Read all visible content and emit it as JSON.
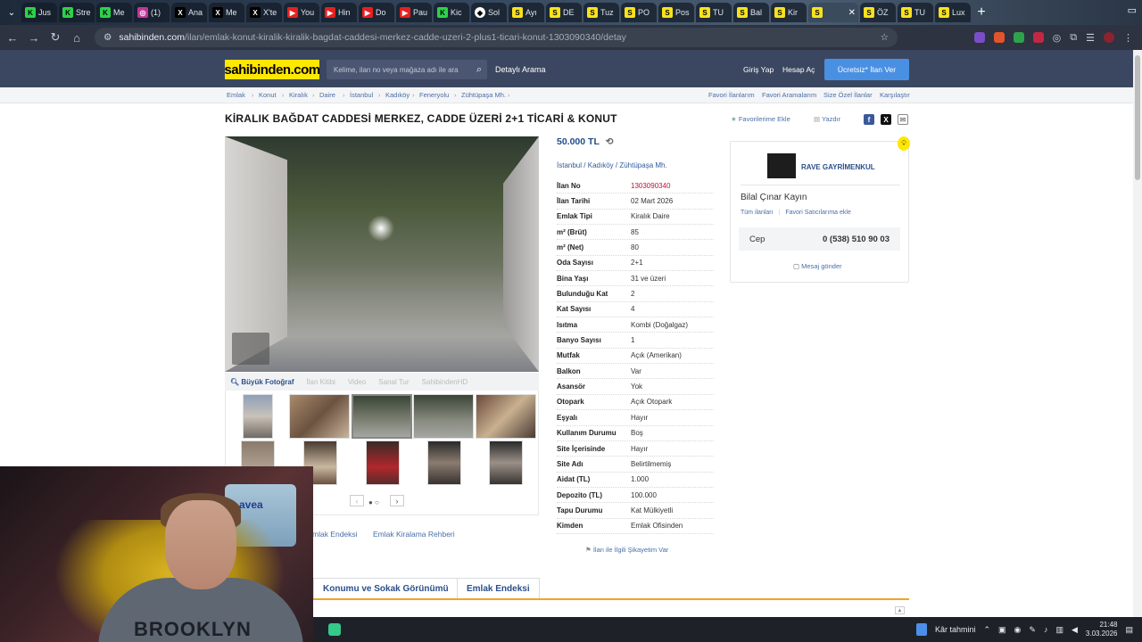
{
  "browser": {
    "tabs": [
      {
        "icon": "k",
        "label": "Jus"
      },
      {
        "icon": "k",
        "label": "Stre"
      },
      {
        "icon": "k",
        "label": "Me"
      },
      {
        "icon": "i",
        "label": "(1)"
      },
      {
        "icon": "x",
        "label": "Ana"
      },
      {
        "icon": "x",
        "label": "Me"
      },
      {
        "icon": "x",
        "label": "X'te"
      },
      {
        "icon": "y",
        "label": "You"
      },
      {
        "icon": "y",
        "label": "Hin"
      },
      {
        "icon": "y",
        "label": "Do"
      },
      {
        "icon": "y",
        "label": "Pau"
      },
      {
        "icon": "k",
        "label": "Kic"
      },
      {
        "icon": "d",
        "label": "Sol"
      },
      {
        "icon": "s",
        "label": "Ayı"
      },
      {
        "icon": "s",
        "label": "DE"
      },
      {
        "icon": "s",
        "label": "Tuz"
      },
      {
        "icon": "s",
        "label": "PO"
      },
      {
        "icon": "s",
        "label": "Pos"
      },
      {
        "icon": "s",
        "label": "TU"
      },
      {
        "icon": "s",
        "label": "Bal"
      },
      {
        "icon": "s",
        "label": "Kir"
      },
      {
        "icon": "s",
        "label": "",
        "active": true
      },
      {
        "icon": "s",
        "label": "ÖZ"
      },
      {
        "icon": "s",
        "label": "TU"
      },
      {
        "icon": "s",
        "label": "Lux"
      }
    ],
    "new_tab": "+",
    "url_host": "sahibinden.com",
    "url_path": "/ilan/emlak-konut-kiralik-kiralik-bagdat-caddesi-merkez-cadde-uzeri-2-plus1-ticari-konut-1303090340/detay"
  },
  "header": {
    "logo": "sahibinden.com",
    "search_placeholder": "Kelime, ilan no veya mağaza adı ile ara",
    "detailed_search": "Detaylı Arama",
    "login": "Giriş Yap",
    "register": "Hesap Aç",
    "cta": "Ücretsiz* İlan Ver"
  },
  "breadcrumb": {
    "items": [
      "Emlak",
      "Konut",
      "Kiralık",
      "Daire",
      "İstanbul",
      "Kadıköy",
      "Feneryolu",
      "Zühtüpaşa Mh."
    ],
    "right_links": [
      "Favori İlanlarım",
      "Favori Aramalarım",
      "Size Özel İlanlar",
      "Karşılaştır"
    ]
  },
  "listing": {
    "title": "KİRALIK BAĞDAT CADDESİ MERKEZ, CADDE ÜZERİ 2+1 TİCARİ & KONUT",
    "add_favorite": "Favorilerime Ekle",
    "print": "Yazdır",
    "price": "50.000 TL",
    "location": [
      "İstanbul",
      "Kadıköy",
      "Zühtüpaşa Mh."
    ],
    "photo_tools": [
      "Büyük Fotoğraf",
      "İlan Kitibi",
      "Video",
      "Sanal Tur",
      "SahibindenHD"
    ],
    "details": [
      {
        "k": "İlan No",
        "v": "1303090340"
      },
      {
        "k": "İlan Tarihi",
        "v": "02 Mart 2026"
      },
      {
        "k": "Emlak Tipi",
        "v": "Kiralık Daire"
      },
      {
        "k": "m² (Brüt)",
        "v": "85"
      },
      {
        "k": "m² (Net)",
        "v": "80"
      },
      {
        "k": "Oda Sayısı",
        "v": "2+1"
      },
      {
        "k": "Bina Yaşı",
        "v": "31 ve üzeri"
      },
      {
        "k": "Bulunduğu Kat",
        "v": "2"
      },
      {
        "k": "Kat Sayısı",
        "v": "4"
      },
      {
        "k": "Isıtma",
        "v": "Kombi (Doğalgaz)"
      },
      {
        "k": "Banyo Sayısı",
        "v": "1"
      },
      {
        "k": "Mutfak",
        "v": "Açık (Amerikan)"
      },
      {
        "k": "Balkon",
        "v": "Var"
      },
      {
        "k": "Asansör",
        "v": "Yok"
      },
      {
        "k": "Otopark",
        "v": "Açık Otopark"
      },
      {
        "k": "Eşyalı",
        "v": "Hayır"
      },
      {
        "k": "Kullanım Durumu",
        "v": "Boş"
      },
      {
        "k": "Site İçerisinde",
        "v": "Hayır"
      },
      {
        "k": "Site Adı",
        "v": "Belirtilmemiş"
      },
      {
        "k": "Aidat (TL)",
        "v": "1.000"
      },
      {
        "k": "Depozito (TL)",
        "v": "100.000"
      },
      {
        "k": "Tapu Durumu",
        "v": "Kat Mülkiyetli"
      },
      {
        "k": "Kimden",
        "v": "Emlak Ofisinden"
      }
    ],
    "complaint": "İlan ile İlgili Şikayetim Var"
  },
  "seller": {
    "store": "RAVE GAYRİMENKUL",
    "agent": "Bilal Çınar Kayın",
    "all_listings": "Tüm ilanları",
    "add_favorite_seller": "Favori Satıcılarıma ekle",
    "phone_label": "Cep",
    "phone": "0 (538) 510 90 03",
    "message": "Mesaj gönder"
  },
  "below": {
    "links": [
      "mlak Endeksi",
      "Emlak Kiralama Rehberi"
    ],
    "tabs": [
      "Konumu ve Sokak Görünümü",
      "Emlak Endeksi"
    ]
  },
  "webcam": {
    "shirt_text": "BROOKLYN",
    "sign_text": "avea"
  },
  "taskbar": {
    "weather": "Kâr tahmini",
    "time": "21:48",
    "date": "3.03.2026"
  }
}
